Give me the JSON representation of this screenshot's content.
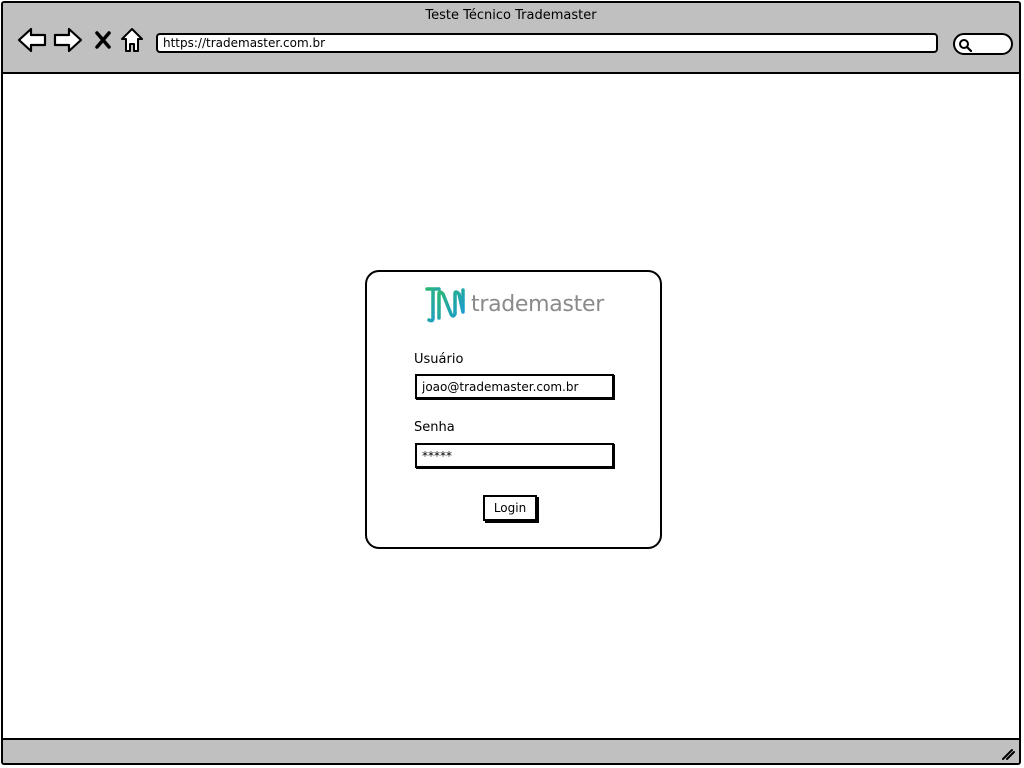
{
  "window": {
    "title": "Teste Técnico Trademaster"
  },
  "browser": {
    "url": "https://trademaster.com.br",
    "nav": {
      "back_icon": "back-arrow-icon",
      "forward_icon": "forward-arrow-icon",
      "stop_icon": "close-icon",
      "home_icon": "home-icon"
    },
    "search_icon": "search-icon"
  },
  "login": {
    "logo_text": "trademaster",
    "logo_colors": {
      "gradient_start": "#2bb673",
      "gradient_end": "#1a9ad6",
      "text": "#8a8a8a"
    },
    "username_label": "Usuário",
    "username_value": "joao@trademaster.com.br",
    "password_label": "Senha",
    "password_value": "*****",
    "submit_label": "Login"
  },
  "colors": {
    "chrome": "#c0c0c0",
    "border": "#000000",
    "background": "#ffffff"
  }
}
